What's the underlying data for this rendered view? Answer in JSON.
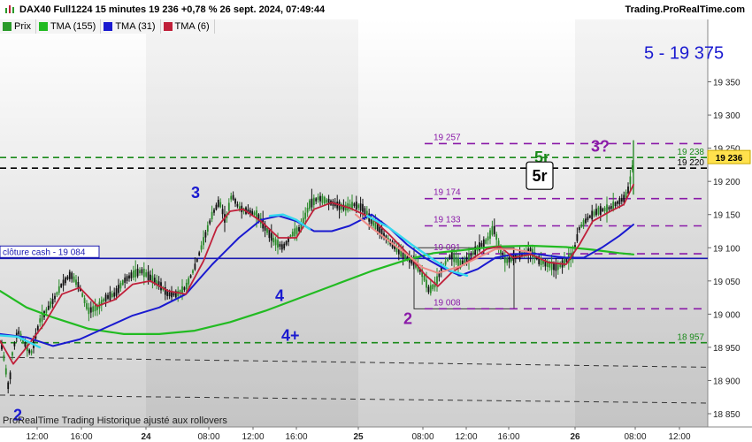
{
  "header": {
    "title": "DAX40 Full1224 15 minutes 19 236 +0,78 % 26 sept. 2024, 07:49:44",
    "site": "Trading.ProRealTime.com",
    "icon": "bar-chart-icon"
  },
  "legend": [
    {
      "label": "Prix",
      "color": "#2a9a2a"
    },
    {
      "label": "TMA (155)",
      "color": "#22bb22"
    },
    {
      "label": "TMA (31)",
      "color": "#1a1ad0"
    },
    {
      "label": "TMA (6)",
      "color": "#c0203a"
    }
  ],
  "footer": "ProRealTime Trading  Historique ajusté aux rollovers",
  "colors": {
    "accent_blue": "#1a1ad0",
    "purple": "#8a1aa8",
    "green_dash": "#1a8a1a"
  },
  "chart_data": {
    "type": "line",
    "ylim": [
      18830,
      19420
    ],
    "yticks": [
      {
        "value": 19350,
        "label": "19 350"
      },
      {
        "value": 19300,
        "label": "19 300"
      },
      {
        "value": 19250,
        "label": "19 250"
      },
      {
        "value": 19200,
        "label": "19 200"
      },
      {
        "value": 19150,
        "label": "19 150"
      },
      {
        "value": 19100,
        "label": "19 100"
      },
      {
        "value": 19050,
        "label": "19 050"
      },
      {
        "value": 19000,
        "label": "19 000"
      },
      {
        "value": 18950,
        "label": "18 950"
      },
      {
        "value": 18900,
        "label": "18 900"
      },
      {
        "value": 18850,
        "label": "18 850"
      }
    ],
    "xticks": [
      {
        "label": "12:00",
        "bold": false
      },
      {
        "label": "16:00",
        "bold": false
      },
      {
        "label": "24",
        "bold": true
      },
      {
        "label": "08:00",
        "bold": false
      },
      {
        "label": "12:00",
        "bold": false
      },
      {
        "label": "16:00",
        "bold": false
      },
      {
        "label": "25",
        "bold": true
      },
      {
        "label": "08:00",
        "bold": false
      },
      {
        "label": "12:00",
        "bold": false
      },
      {
        "label": "16:00",
        "bold": false
      },
      {
        "label": "26",
        "bold": true
      },
      {
        "label": "08:00",
        "bold": false
      },
      {
        "label": "12:00",
        "bold": false
      }
    ],
    "price_path": [
      [
        0,
        18965
      ],
      [
        5,
        18930
      ],
      [
        10,
        18885
      ],
      [
        14,
        18940
      ],
      [
        20,
        18975
      ],
      [
        28,
        18955
      ],
      [
        35,
        18940
      ],
      [
        45,
        18990
      ],
      [
        60,
        19020
      ],
      [
        70,
        19045
      ],
      [
        80,
        19060
      ],
      [
        90,
        19040
      ],
      [
        100,
        19005
      ],
      [
        110,
        19010
      ],
      [
        120,
        19025
      ],
      [
        130,
        19030
      ],
      [
        140,
        19050
      ],
      [
        150,
        19060
      ],
      [
        160,
        19065
      ],
      [
        170,
        19055
      ],
      [
        180,
        19045
      ],
      [
        190,
        19030
      ],
      [
        200,
        19030
      ],
      [
        210,
        19040
      ],
      [
        220,
        19070
      ],
      [
        230,
        19110
      ],
      [
        240,
        19150
      ],
      [
        248,
        19170
      ],
      [
        255,
        19140
      ],
      [
        262,
        19180
      ],
      [
        270,
        19160
      ],
      [
        280,
        19155
      ],
      [
        290,
        19150
      ],
      [
        300,
        19130
      ],
      [
        310,
        19110
      ],
      [
        320,
        19100
      ],
      [
        330,
        19120
      ],
      [
        340,
        19130
      ],
      [
        350,
        19165
      ],
      [
        360,
        19175
      ],
      [
        370,
        19170
      ],
      [
        380,
        19165
      ],
      [
        390,
        19160
      ],
      [
        400,
        19165
      ],
      [
        410,
        19160
      ],
      [
        420,
        19140
      ],
      [
        430,
        19125
      ],
      [
        440,
        19110
      ],
      [
        450,
        19095
      ],
      [
        460,
        19085
      ],
      [
        470,
        19075
      ],
      [
        478,
        19060
      ],
      [
        485,
        19035
      ],
      [
        492,
        19045
      ],
      [
        500,
        19070
      ],
      [
        510,
        19090
      ],
      [
        520,
        19075
      ],
      [
        530,
        19085
      ],
      [
        540,
        19100
      ],
      [
        550,
        19110
      ],
      [
        558,
        19130
      ],
      [
        565,
        19100
      ],
      [
        572,
        19080
      ],
      [
        580,
        19085
      ],
      [
        590,
        19090
      ],
      [
        600,
        19095
      ],
      [
        610,
        19080
      ],
      [
        620,
        19075
      ],
      [
        630,
        19070
      ],
      [
        640,
        19080
      ],
      [
        648,
        19090
      ],
      [
        655,
        19130
      ],
      [
        665,
        19145
      ],
      [
        675,
        19155
      ],
      [
        690,
        19160
      ],
      [
        700,
        19170
      ],
      [
        706,
        19175
      ],
      [
        711,
        19190
      ],
      [
        714,
        19215
      ],
      [
        717,
        19236
      ]
    ],
    "series": [
      {
        "name": "TMA (155)",
        "color": "#22bb22",
        "width": 2.2,
        "points": [
          [
            0,
            19035
          ],
          [
            30,
            19010
          ],
          [
            60,
            18995
          ],
          [
            100,
            18978
          ],
          [
            140,
            18970
          ],
          [
            180,
            18970
          ],
          [
            220,
            18975
          ],
          [
            260,
            18988
          ],
          [
            300,
            19005
          ],
          [
            340,
            19025
          ],
          [
            380,
            19045
          ],
          [
            420,
            19065
          ],
          [
            460,
            19082
          ],
          [
            490,
            19092
          ],
          [
            520,
            19096
          ],
          [
            560,
            19102
          ],
          [
            600,
            19103
          ],
          [
            640,
            19101
          ],
          [
            670,
            19097
          ],
          [
            700,
            19092
          ],
          [
            716,
            19090
          ]
        ]
      },
      {
        "name": "TMA (31)",
        "color": "#1a1ad0",
        "width": 2,
        "points": [
          [
            0,
            18970
          ],
          [
            30,
            18965
          ],
          [
            60,
            18952
          ],
          [
            90,
            18962
          ],
          [
            120,
            18980
          ],
          [
            150,
            18998
          ],
          [
            180,
            19010
          ],
          [
            210,
            19030
          ],
          [
            240,
            19075
          ],
          [
            270,
            19115
          ],
          [
            295,
            19142
          ],
          [
            315,
            19148
          ],
          [
            335,
            19140
          ],
          [
            355,
            19125
          ],
          [
            375,
            19125
          ],
          [
            395,
            19133
          ],
          [
            420,
            19150
          ],
          [
            440,
            19130
          ],
          [
            460,
            19105
          ],
          [
            480,
            19085
          ],
          [
            500,
            19070
          ],
          [
            520,
            19058
          ],
          [
            540,
            19068
          ],
          [
            560,
            19085
          ],
          [
            580,
            19090
          ],
          [
            600,
            19092
          ],
          [
            620,
            19088
          ],
          [
            640,
            19085
          ],
          [
            660,
            19085
          ],
          [
            680,
            19100
          ],
          [
            700,
            19118
          ],
          [
            716,
            19135
          ]
        ]
      },
      {
        "name": "TMA (6)",
        "color": "#c0203a",
        "width": 1.8,
        "points": [
          [
            0,
            18960
          ],
          [
            15,
            18925
          ],
          [
            30,
            18950
          ],
          [
            50,
            18985
          ],
          [
            70,
            19030
          ],
          [
            90,
            19040
          ],
          [
            110,
            19012
          ],
          [
            130,
            19022
          ],
          [
            150,
            19045
          ],
          [
            170,
            19050
          ],
          [
            190,
            19035
          ],
          [
            210,
            19030
          ],
          [
            230,
            19080
          ],
          [
            245,
            19130
          ],
          [
            260,
            19155
          ],
          [
            275,
            19158
          ],
          [
            295,
            19140
          ],
          [
            315,
            19115
          ],
          [
            335,
            19115
          ],
          [
            355,
            19158
          ],
          [
            375,
            19168
          ],
          [
            395,
            19160
          ],
          [
            420,
            19145
          ],
          [
            440,
            19120
          ],
          [
            460,
            19092
          ],
          [
            480,
            19060
          ],
          [
            495,
            19042
          ],
          [
            510,
            19062
          ],
          [
            530,
            19080
          ],
          [
            550,
            19098
          ],
          [
            565,
            19102
          ],
          [
            580,
            19085
          ],
          [
            600,
            19090
          ],
          [
            620,
            19078
          ],
          [
            640,
            19075
          ],
          [
            655,
            19105
          ],
          [
            670,
            19140
          ],
          [
            690,
            19155
          ],
          [
            705,
            19165
          ],
          [
            716,
            19195
          ]
        ]
      },
      {
        "name": "cyan-overlay-1",
        "color": "#35d8ee",
        "width": 2.4,
        "points": [
          [
            0,
            18968
          ],
          [
            20,
            18966
          ],
          [
            45,
            18950
          ]
        ]
      },
      {
        "name": "cyan-overlay-2",
        "color": "#35d8ee",
        "width": 2.4,
        "points": [
          [
            305,
            19148
          ],
          [
            320,
            19150
          ],
          [
            335,
            19142
          ],
          [
            350,
            19128
          ]
        ]
      },
      {
        "name": "cyan-overlay-3",
        "color": "#35d8ee",
        "width": 2.4,
        "points": [
          [
            415,
            19148
          ],
          [
            440,
            19130
          ],
          [
            465,
            19105
          ],
          [
            490,
            19082
          ],
          [
            510,
            19065
          ],
          [
            528,
            19058
          ]
        ]
      },
      {
        "name": "salmon-overlay",
        "color": "#ec8b86",
        "width": 2,
        "points": [
          [
            402,
            19150
          ],
          [
            420,
            19130
          ],
          [
            440,
            19110
          ],
          [
            460,
            19090
          ],
          [
            478,
            19070
          ],
          [
            495,
            19062
          ],
          [
            520,
            19072
          ],
          [
            540,
            19085
          ],
          [
            560,
            19098
          ],
          [
            580,
            19098
          ],
          [
            600,
            19093
          ]
        ]
      }
    ],
    "levels": [
      {
        "value": 19236,
        "color": "#1a8a1a",
        "dash": "7,5",
        "label": "19 238",
        "label_color": "#1a8a1a",
        "label_side": "right-inner"
      },
      {
        "value": 19220,
        "color": "#000000",
        "dash": "7,5",
        "label": "19 220",
        "label_color": "#000000",
        "label_side": "right-inner"
      },
      {
        "value": 19257,
        "color": "#8a1aa8",
        "dash": "9,7",
        "label": "19 257",
        "label_color": "#8a1aa8",
        "label_side": "left"
      },
      {
        "value": 19174,
        "color": "#8a1aa8",
        "dash": "9,7",
        "label": "19 174",
        "label_color": "#8a1aa8",
        "label_side": "left"
      },
      {
        "value": 19133,
        "color": "#8a1aa8",
        "dash": "9,7",
        "label": "19 133",
        "label_color": "#8a1aa8",
        "label_side": "left"
      },
      {
        "value": 19091,
        "color": "#8a1aa8",
        "dash": "9,7",
        "label": "19 091",
        "label_color": "#8a1aa8",
        "label_side": "left"
      },
      {
        "value": 19008,
        "color": "#8a1aa8",
        "dash": "9,7",
        "label": "19 008",
        "label_color": "#8a1aa8",
        "label_side": "left"
      },
      {
        "value": 19084,
        "color": "#1a1ab0",
        "dash": "",
        "label": "clôture cash -  19 084",
        "label_color": "#1a1ab0",
        "label_side": "box-left"
      },
      {
        "value": 18957,
        "color": "#1a8a1a",
        "dash": "7,5",
        "label": "18 957",
        "label_color": "#1a8a1a",
        "label_side": "right-inner"
      }
    ],
    "price_tag": {
      "value": 19236,
      "label": "19 236"
    },
    "annotations": [
      {
        "text": "3",
        "color": "#1a1ad0",
        "size": 18,
        "x": 216,
        "value": 19175
      },
      {
        "text": "4",
        "color": "#1a1ad0",
        "size": 18,
        "x": 311,
        "value": 19020
      },
      {
        "text": "4+",
        "color": "#1a1ad0",
        "size": 18,
        "x": 318,
        "value": 18960
      },
      {
        "text": "2",
        "color": "#1a1ad0",
        "size": 18,
        "x": 15,
        "value": 18840
      },
      {
        "text": "2",
        "color": "#8a1aa8",
        "size": 18,
        "x": 456,
        "value": 18985
      },
      {
        "text": "3?",
        "color": "#8a1aa8",
        "size": 18,
        "x": 668,
        "value": 19245
      },
      {
        "text": "5r",
        "color": "#1a8a1a",
        "size": 18,
        "x": 604,
        "value": 19228
      },
      {
        "text": "5 - 19 375",
        "color": "#1a1ad0",
        "size": 20,
        "x": 728,
        "value": 19385
      }
    ],
    "boxed_label": {
      "text": "5r",
      "x": 609,
      "value": 19208
    },
    "rectangle": {
      "x1": 468,
      "x2": 581,
      "v1": 19100,
      "v2": 19008
    }
  }
}
